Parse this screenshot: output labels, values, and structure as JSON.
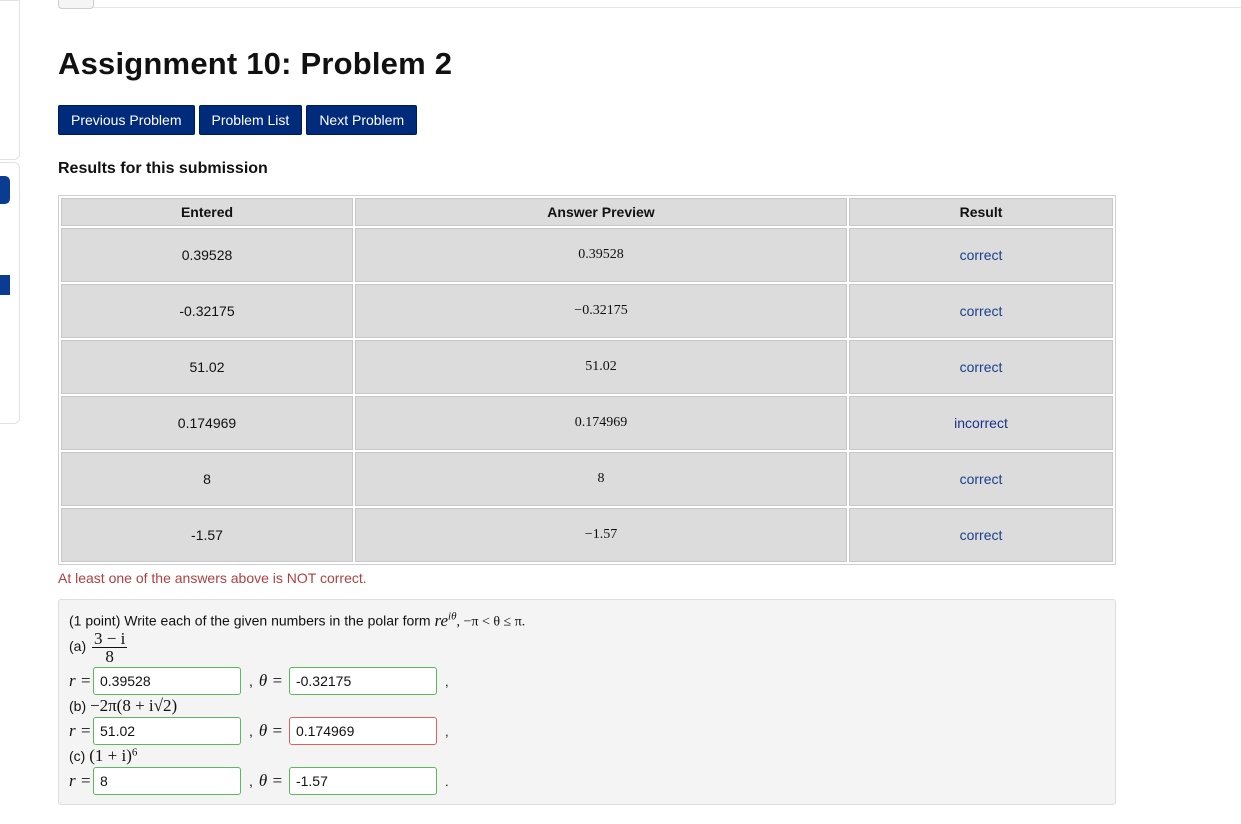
{
  "title": "Assignment 10: Problem 2",
  "nav": {
    "previous": "Previous Problem",
    "list": "Problem List",
    "next": "Next Problem"
  },
  "results": {
    "heading": "Results for this submission",
    "columns": [
      "Entered",
      "Answer Preview",
      "Result"
    ],
    "rows": [
      {
        "entered": "0.39528",
        "preview": "0.39528",
        "result": "correct"
      },
      {
        "entered": "-0.32175",
        "preview": "−0.32175",
        "result": "correct"
      },
      {
        "entered": "51.02",
        "preview": "51.02",
        "result": "correct"
      },
      {
        "entered": "0.174969",
        "preview": "0.174969",
        "result": "incorrect"
      },
      {
        "entered": "8",
        "preview": "8",
        "result": "correct"
      },
      {
        "entered": "-1.57",
        "preview": "−1.57",
        "result": "correct"
      }
    ],
    "message": "At least one of the answers above is NOT correct."
  },
  "problem": {
    "intro": "(1 point) Write each of the given numbers in the polar form",
    "polar_form": "re",
    "polar_exp": "iθ",
    "range": ", −π < θ ≤ π.",
    "parts": [
      {
        "label": "(a)",
        "expr_num": "3 − i",
        "expr_den": "8",
        "r": "0.39528",
        "theta": "-0.32175",
        "r_status": "ok",
        "theta_status": "ok",
        "trail": ","
      },
      {
        "label": "(b)",
        "expr": "−2π(8 + i√2)",
        "r": "51.02",
        "theta": "0.174969",
        "r_status": "ok",
        "theta_status": "bad",
        "trail": ","
      },
      {
        "label": "(c)",
        "expr": "(1 + i)",
        "expr_exp": "6",
        "r": "8",
        "theta": "-1.57",
        "r_status": "ok",
        "theta_status": "ok",
        "trail": "."
      }
    ],
    "r_label": "r =",
    "theta_label": "θ =",
    "comma": ","
  },
  "colors": {
    "button": "#002a7a",
    "correct": "#8cff8c",
    "incorrect": "#d48f8f",
    "error_text": "#b04040"
  }
}
